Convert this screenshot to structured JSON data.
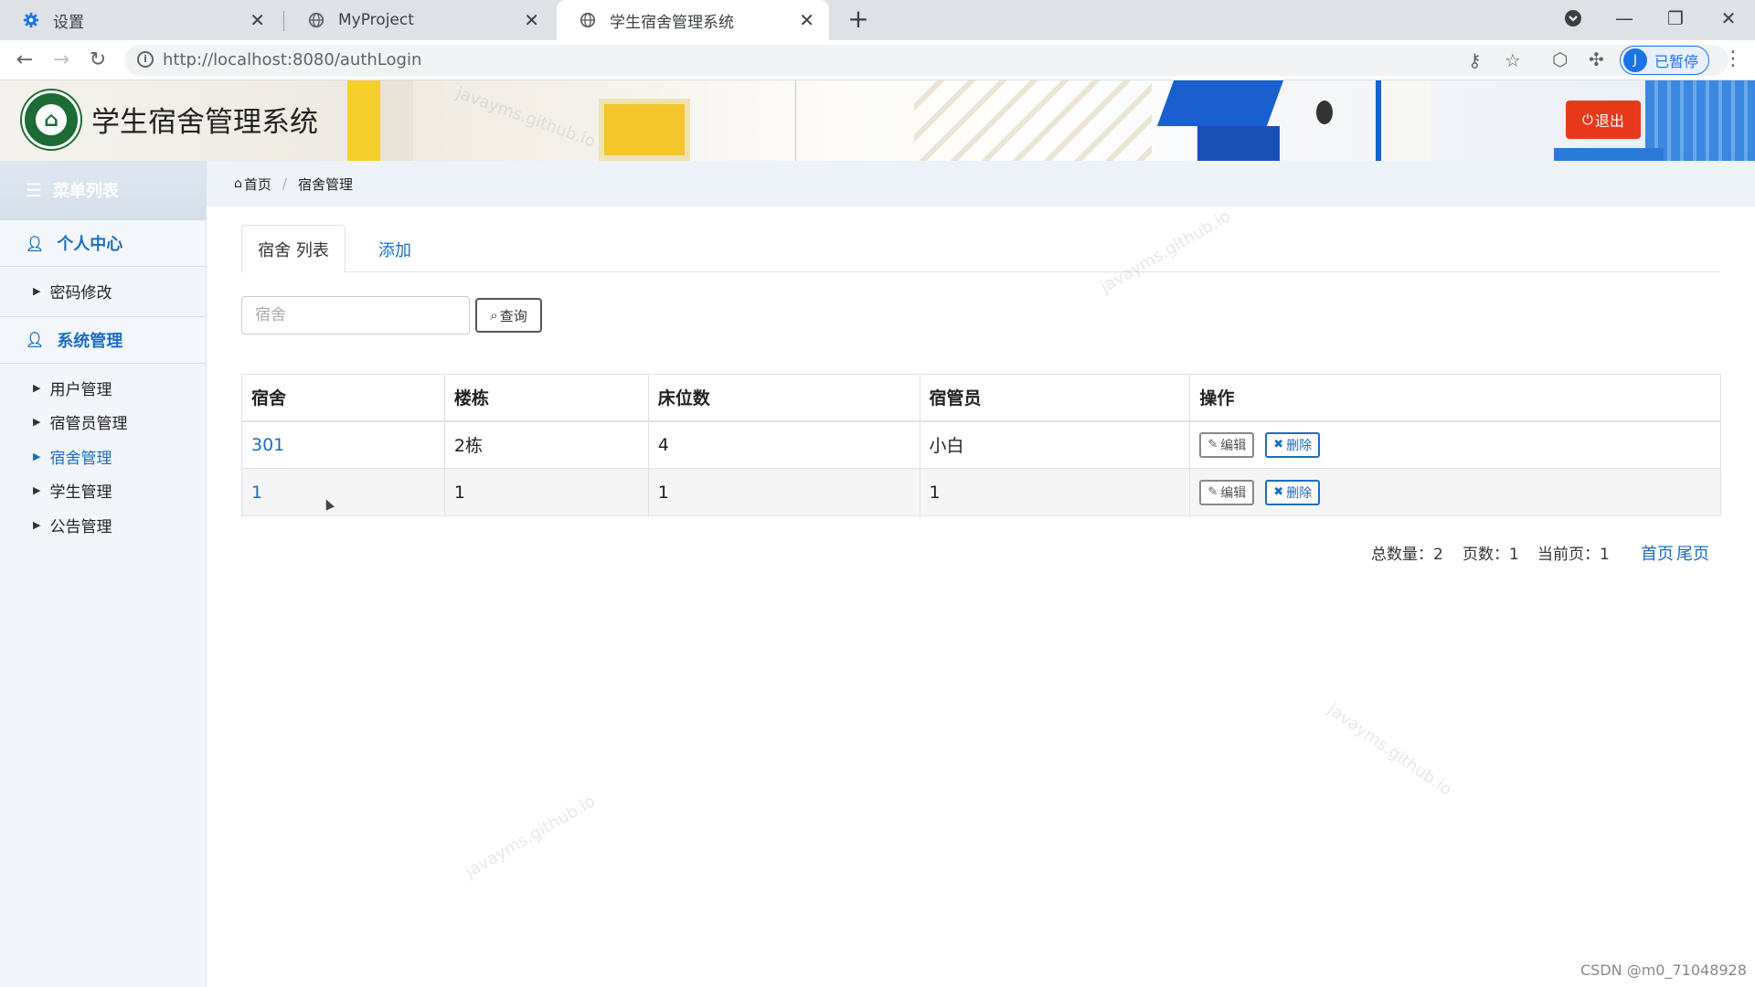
{
  "browser": {
    "tabs": [
      {
        "title": "设置",
        "icon": "gear-icon"
      },
      {
        "title": "MyProject",
        "icon": "globe-icon"
      },
      {
        "title": "学生宿舍管理系统",
        "icon": "globe-icon"
      }
    ],
    "active_tab": 2,
    "url_host": "http://localhost",
    "url_rest": ":8080/authLogin",
    "profile_initial": "J",
    "profile_label": "已暂停"
  },
  "header": {
    "title": "学生宿舍管理系统",
    "logout_label": "退出",
    "logout_color": "#e8381c"
  },
  "sidebar": {
    "menu_title": "菜单列表",
    "sections": [
      {
        "label": "个人中心",
        "items": [
          {
            "label": "密码修改",
            "active": false
          }
        ]
      },
      {
        "label": "系统管理",
        "items": [
          {
            "label": "用户管理",
            "active": false
          },
          {
            "label": "宿管员管理",
            "active": false
          },
          {
            "label": "宿舍管理",
            "active": true
          },
          {
            "label": "学生管理",
            "active": false
          },
          {
            "label": "公告管理",
            "active": false
          }
        ]
      }
    ]
  },
  "breadcrumb": {
    "home": "首页",
    "current": "宿舍管理"
  },
  "tabs": {
    "list": "宿舍 列表",
    "add": "添加"
  },
  "search": {
    "placeholder": "宿舍",
    "value": "",
    "button": "查询"
  },
  "table": {
    "columns": [
      "宿舍",
      "楼栋",
      "床位数",
      "宿管员",
      "操作"
    ],
    "rows": [
      {
        "dorm": "301",
        "building": "2栋",
        "beds": "4",
        "manager": "小白"
      },
      {
        "dorm": "1",
        "building": "1",
        "beds": "1",
        "manager": "1"
      }
    ],
    "edit_label": "编辑",
    "delete_label": "删除"
  },
  "pager": {
    "total_label": "总数量：",
    "total": "2",
    "pages_label": "页数：",
    "pages": "1",
    "current_label": "当前页：",
    "current": "1",
    "first": "首页",
    "last": "尾页"
  },
  "watermark_text": "javayms.github.io",
  "footer_credit": "CSDN @m0_71048928",
  "colors": {
    "accent": "#1b6cc2",
    "logout": "#e8381c",
    "sidebar_bg": "#f2f6fb"
  }
}
